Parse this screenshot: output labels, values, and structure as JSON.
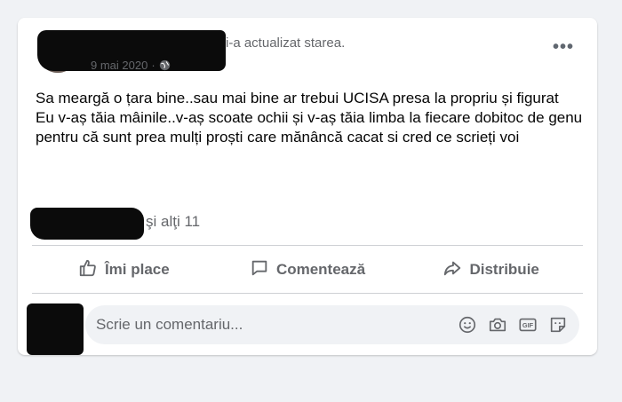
{
  "post": {
    "header_suffix": "i-a actualizat starea.",
    "date": "9 mai 2020",
    "meta_separator": "·",
    "privacy_icon": "globe-icon",
    "more_label": "•••",
    "text_lines": [
      "Sa meargă o țara bine..sau mai bine ar trebui UCISA presa la propriu și figurat",
      "Eu v-aș tăia mâinile..v-aș scoate ochii și v-aș tăia limba la fiecare dobitoc de genu pentru că sunt prea mulți proști care mănâncă cacat si cred ce scrieți voi"
    ],
    "likes_others": "şi alţi 11"
  },
  "actions": {
    "like_label": "Îmi place",
    "comment_label": "Comentează",
    "share_label": "Distribuie",
    "like_icon": "thumbs-up-icon",
    "comment_icon": "speech-bubble-icon",
    "share_icon": "share-arrow-icon"
  },
  "comment_input": {
    "placeholder": "Scrie un comentariu...",
    "tool_icons": [
      "emoji-icon",
      "camera-icon",
      "gif-icon",
      "sticker-icon"
    ],
    "gif_label": "GIF"
  },
  "colors": {
    "background": "#f0f2f5",
    "card": "#ffffff",
    "secondary_text": "#65676b",
    "primary_text": "#050505",
    "redaction": "#0b0b0b"
  }
}
